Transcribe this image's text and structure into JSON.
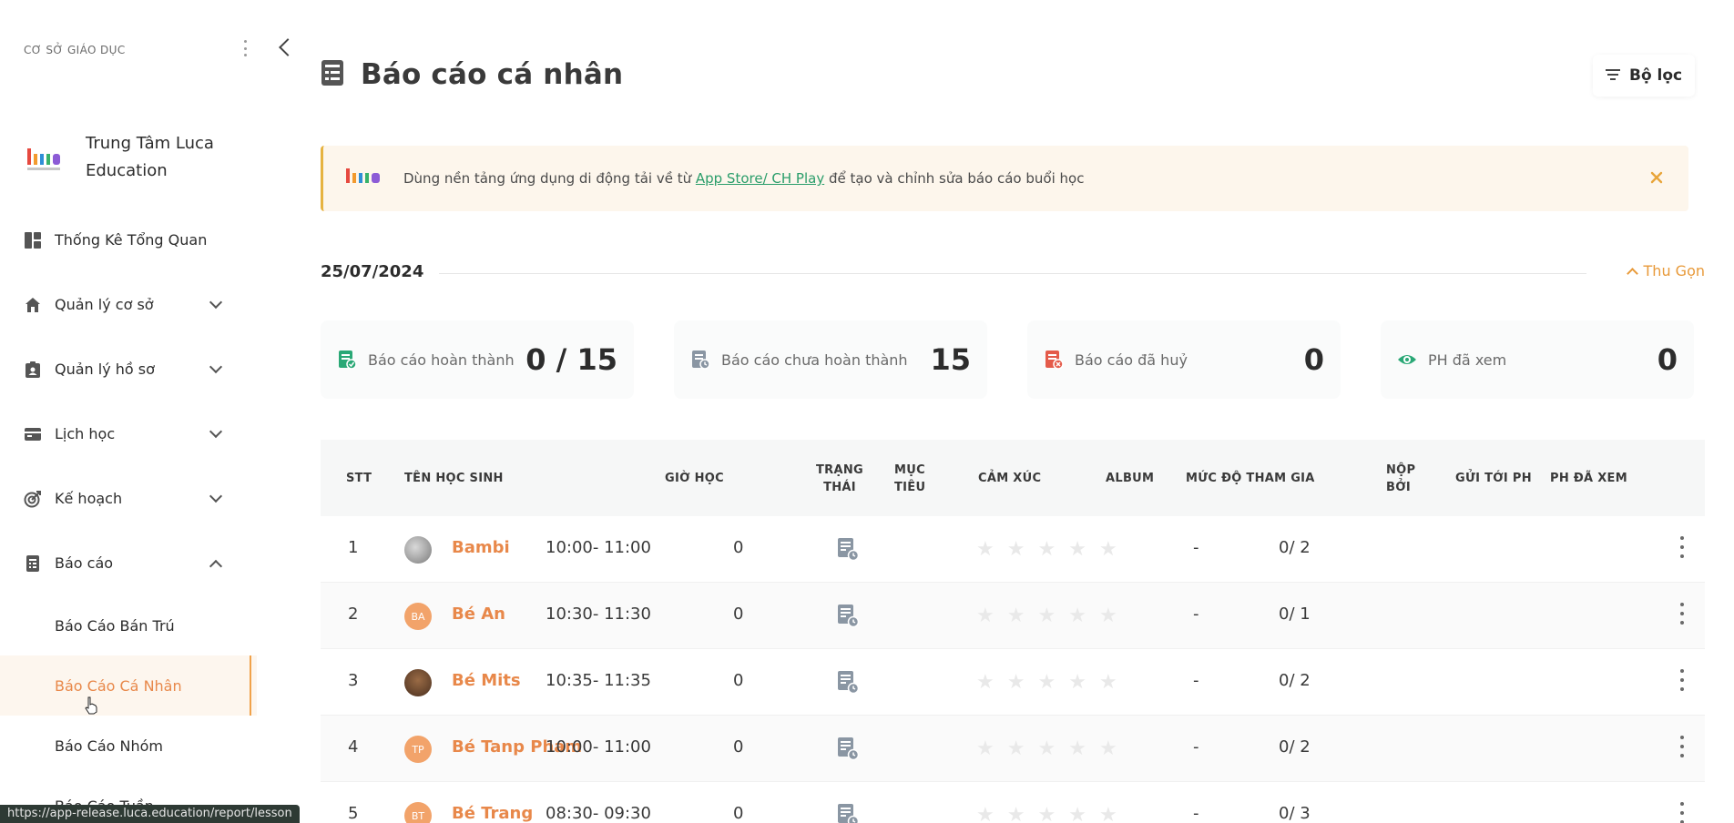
{
  "sidebar": {
    "org_label": "CƠ SỞ GIÁO DỤC",
    "brand_name": "Trung Tâm Luca Education",
    "items": [
      {
        "label": "Thống Kê Tổng Quan",
        "icon": "dashboard-icon",
        "expandable": false
      },
      {
        "label": "Quản lý cơ sở",
        "icon": "home-icon",
        "expandable": true
      },
      {
        "label": "Quản lý hồ sơ",
        "icon": "profile-icon",
        "expandable": true
      },
      {
        "label": "Lịch học",
        "icon": "calendar-icon",
        "expandable": true
      },
      {
        "label": "Kế hoạch",
        "icon": "target-icon",
        "expandable": true
      },
      {
        "label": "Báo cáo",
        "icon": "report-icon",
        "expandable": true,
        "expanded": true
      }
    ],
    "sub_items": [
      {
        "label": "Báo Cáo Bán Trú",
        "active": false
      },
      {
        "label": "Báo Cáo Cá Nhân",
        "active": true
      },
      {
        "label": "Báo Cáo Nhóm",
        "active": false
      },
      {
        "label": "Báo Cáo Tuần",
        "active": false
      }
    ]
  },
  "header": {
    "title": "Báo cáo cá nhân",
    "filter_label": "Bộ lọc"
  },
  "banner": {
    "text_before": "Dùng nền tảng ứng dụng di động tải về từ ",
    "link_text": "App Store/ CH Play",
    "text_after": " để tạo và chỉnh sửa báo cáo buổi học"
  },
  "date_section": {
    "date": "25/07/2024",
    "collapse_label": "Thu Gọn"
  },
  "stats": [
    {
      "label": "Báo cáo hoàn thành",
      "value": "0 / 15",
      "icon": "report-done-icon",
      "color": "#2aa876"
    },
    {
      "label": "Báo cáo chưa hoàn thành",
      "value": "15",
      "icon": "report-pending-icon",
      "color": "#8a96a3"
    },
    {
      "label": "Báo cáo đã huỷ",
      "value": "0",
      "icon": "report-cancel-icon",
      "color": "#e45b4a"
    },
    {
      "label": "PH đã xem",
      "value": "0",
      "icon": "eye-icon",
      "color": "#2aa876"
    }
  ],
  "table": {
    "columns": [
      "STT",
      "TÊN HỌC SINH",
      "GIỜ HỌC",
      "TRẠNG THÁI",
      "MỤC TIÊU",
      "CẢM XÚC",
      "ALBUM",
      "MỨC ĐỘ THAM GIA",
      "NỘP BỞI",
      "GỬI TỚI PH",
      "PH ĐÃ XEM"
    ],
    "rows": [
      {
        "stt": "1",
        "name": "Bambi",
        "avatar": "photo",
        "avatar_text": "",
        "time": "10:00- 11:00",
        "target": "0",
        "sent": "-",
        "viewed": "0/ 2"
      },
      {
        "stt": "2",
        "name": "Bé An",
        "avatar": "initials",
        "avatar_text": "BA",
        "time": "10:30- 11:30",
        "target": "0",
        "sent": "-",
        "viewed": "0/ 1"
      },
      {
        "stt": "3",
        "name": "Bé Mits",
        "avatar": "photo",
        "avatar_text": "",
        "time": "10:35- 11:35",
        "target": "0",
        "sent": "-",
        "viewed": "0/ 2"
      },
      {
        "stt": "4",
        "name": "Bé Tanp Pham",
        "avatar": "initials",
        "avatar_text": "TP",
        "time": "10:00- 11:00",
        "target": "0",
        "sent": "-",
        "viewed": "0/ 2"
      },
      {
        "stt": "5",
        "name": "Bé Trang",
        "avatar": "initials",
        "avatar_text": "BT",
        "time": "08:30- 09:30",
        "target": "0",
        "sent": "-",
        "viewed": "0/ 3"
      }
    ]
  },
  "status_bar": {
    "url": "https://app-release.luca.education/report/lesson"
  },
  "colors": {
    "accent": "#e8884a",
    "link": "#2a9d6a",
    "banner_bg": "#fdf6ec",
    "banner_border": "#e6b341"
  }
}
